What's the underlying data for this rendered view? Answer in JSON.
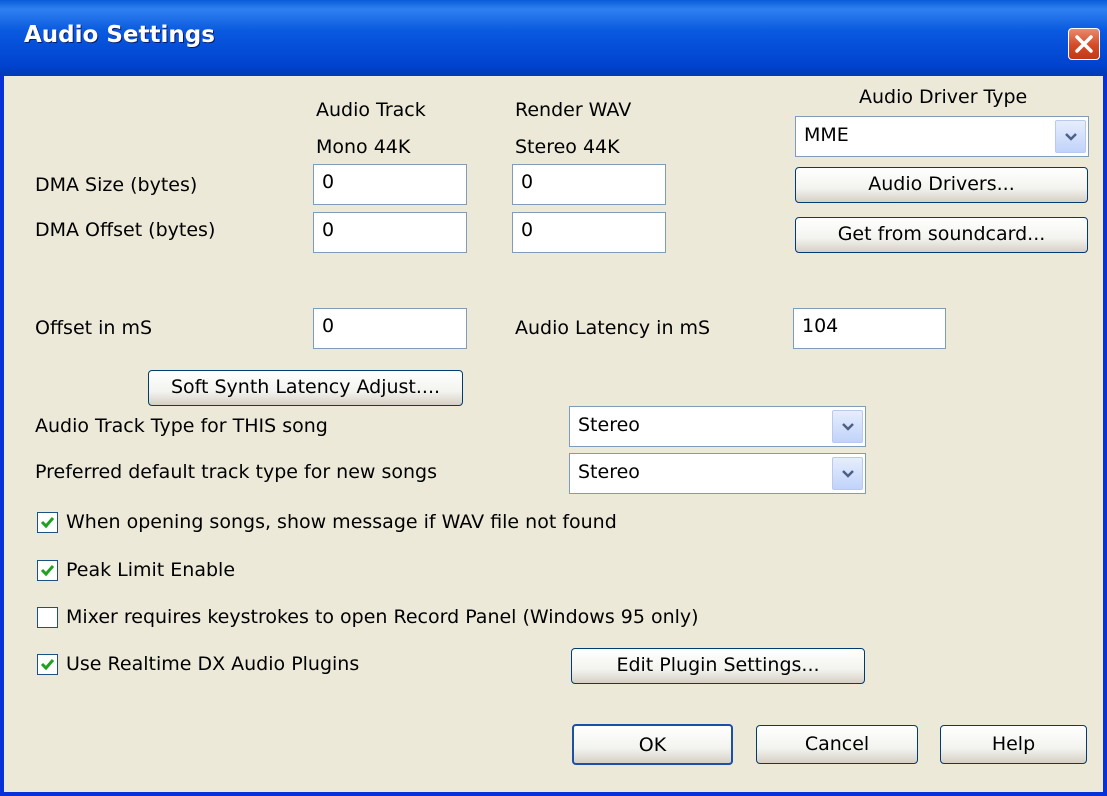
{
  "window": {
    "title": "Audio Settings"
  },
  "headers": {
    "audio_track": "Audio Track",
    "audio_track_sub": "Mono 44K",
    "render_wav": "Render WAV",
    "render_wav_sub": "Stereo 44K",
    "audio_driver_type": "Audio Driver Type"
  },
  "fields": {
    "dma_size_label": "DMA Size (bytes)",
    "dma_size_audio": "0",
    "dma_size_render": "0",
    "dma_offset_label": "DMA Offset (bytes)",
    "dma_offset_audio": "0",
    "dma_offset_render": "0",
    "offset_ms_label": "Offset in mS",
    "offset_ms": "0",
    "latency_label": "Audio Latency in mS",
    "latency_ms": "104"
  },
  "driver": {
    "selected": "MME"
  },
  "buttons": {
    "audio_drivers": "Audio Drivers...",
    "get_from_soundcard": "Get from soundcard...",
    "soft_synth": "Soft Synth Latency Adjust....",
    "edit_plugin": "Edit Plugin Settings...",
    "ok": "OK",
    "cancel": "Cancel",
    "help": "Help"
  },
  "track_type": {
    "this_song_label": "Audio Track Type for THIS song",
    "this_song_value": "Stereo",
    "default_label": "Preferred default track type for new songs",
    "default_value": "Stereo"
  },
  "checkboxes": {
    "show_message": {
      "label": "When opening songs, show message if WAV file not found",
      "checked": true
    },
    "peak_limit": {
      "label": "Peak Limit Enable",
      "checked": true
    },
    "mixer_keystrokes": {
      "label": "Mixer requires keystrokes to open Record Panel (Windows 95 only)",
      "checked": false
    },
    "realtime_dx": {
      "label": "Use Realtime DX Audio Plugins",
      "checked": true
    }
  },
  "colors": {
    "titlebar": "#0a5ae0",
    "dialog_bg": "#ece9d8",
    "close": "#d44a25",
    "check": "#21a121"
  }
}
